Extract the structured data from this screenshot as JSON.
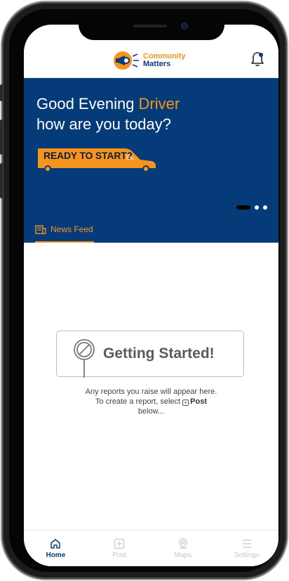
{
  "header": {
    "logo_line1": "Community",
    "logo_line2": "Matters",
    "icons": [
      "megaphone-logo-icon",
      "bell-icon"
    ]
  },
  "hero": {
    "greeting_line1_prefix": "Good Evening ",
    "greeting_name": "Driver",
    "greeting_line2": "how are you today?",
    "cta_label": "READY TO START?",
    "carousel_pages": 3,
    "carousel_active_index": 0
  },
  "tabs": [
    {
      "label": "News Feed",
      "icon": "news-feed-icon",
      "active": true
    }
  ],
  "empty_state": {
    "title": "Getting Started!",
    "line1": "Any reports you raise will appear here.",
    "line2_prefix": "To create a report, select ",
    "line2_post": "Post",
    "line3": "below..."
  },
  "bottom_nav": [
    {
      "label": "Home",
      "icon": "home-icon",
      "active": true
    },
    {
      "label": "Post",
      "icon": "plus-square-icon",
      "active": false
    },
    {
      "label": "Maps",
      "icon": "map-pin-icon",
      "active": false
    },
    {
      "label": "Settings",
      "icon": "menu-icon",
      "active": false
    }
  ],
  "colors": {
    "brand_blue": "#063b7a",
    "brand_orange": "#f7941d",
    "inactive_grey": "#c8c8c8"
  }
}
